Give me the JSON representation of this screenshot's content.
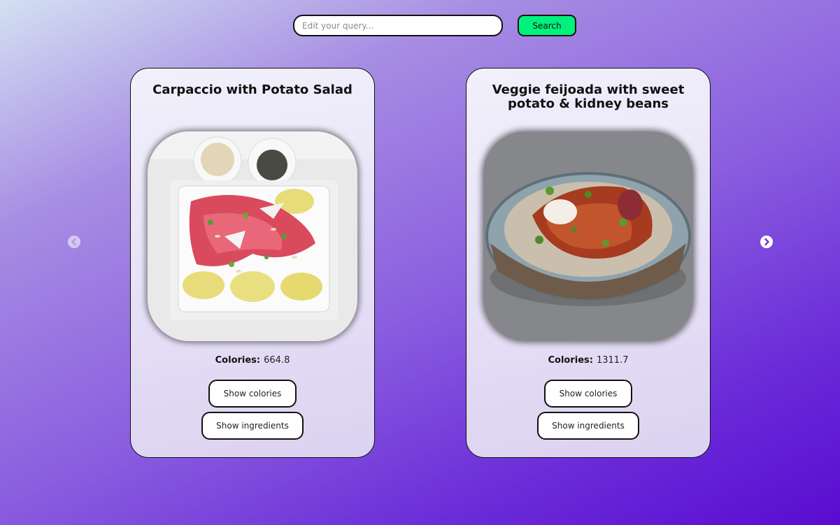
{
  "search": {
    "placeholder": "Edit your query...",
    "button_label": "Search",
    "button_color": "#00f27d"
  },
  "carousel": {
    "prev_icon": "chevron-left-icon",
    "next_icon": "chevron-right-icon"
  },
  "recipes": [
    {
      "title": "Carpaccio with Potato Salad",
      "image": "carpaccio-plate-photo",
      "calories_label": "Colories:",
      "calories_value": "664.8",
      "show_calories_label": "Show colories",
      "show_ingredients_label": "Show ingredients"
    },
    {
      "title": "Veggie feijoada with sweet potato & kidney beans",
      "image": "feijoada-bowl-photo",
      "calories_label": "Colories:",
      "calories_value": "1311.7",
      "show_calories_label": "Show colories",
      "show_ingredients_label": "Show ingredients"
    }
  ]
}
